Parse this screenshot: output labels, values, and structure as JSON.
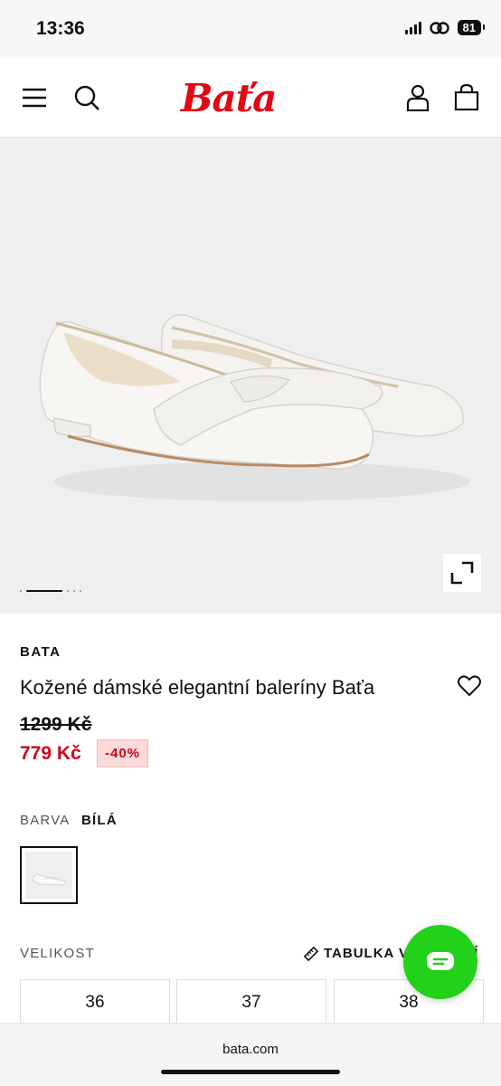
{
  "status_bar": {
    "time": "13:36",
    "battery": "81"
  },
  "header": {
    "logo": "Baťa"
  },
  "product": {
    "brand": "BATA",
    "title": "Kožené dámské elegantní baleríny Baťa",
    "old_price": "1299 Kč",
    "new_price": "779 Kč",
    "discount": "-40%"
  },
  "color": {
    "label": "BARVA",
    "value": "BÍLÁ"
  },
  "size": {
    "label": "VELIKOST",
    "table_link": "TABULKA VELIKOSTÍ",
    "options": [
      "36",
      "37",
      "38"
    ]
  },
  "browser": {
    "url": "bata.com"
  },
  "colors": {
    "accent_red": "#e30613",
    "chat_green": "#22d11a"
  }
}
